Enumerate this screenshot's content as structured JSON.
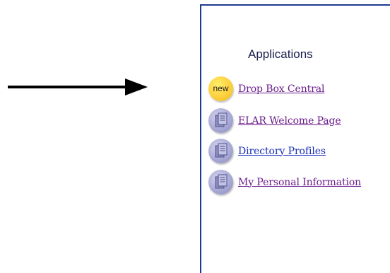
{
  "panel": {
    "title": "Applications"
  },
  "apps": [
    {
      "badge": "new",
      "label": "Drop Box Central",
      "icon": "new-badge-icon"
    },
    {
      "label": "ELAR Welcome Page",
      "icon": "document-icon"
    },
    {
      "label": "Directory Profiles",
      "icon": "document-icon"
    },
    {
      "label": "My Personal Information",
      "icon": "document-icon"
    }
  ],
  "colors": {
    "link": "#6a1b8c",
    "link_alt": "#1a2fb8",
    "panel_border": "#1f3a93",
    "title": "#1a1f4d"
  }
}
